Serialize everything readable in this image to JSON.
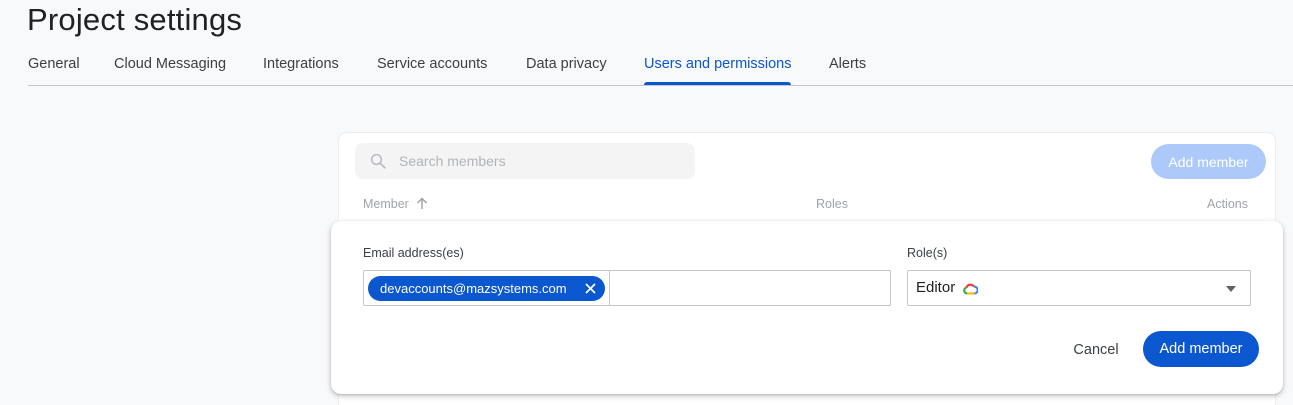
{
  "page": {
    "title": "Project settings"
  },
  "tabs": [
    {
      "label": "General",
      "active": false
    },
    {
      "label": "Cloud Messaging",
      "active": false
    },
    {
      "label": "Integrations",
      "active": false
    },
    {
      "label": "Service accounts",
      "active": false
    },
    {
      "label": "Data privacy",
      "active": false
    },
    {
      "label": "Users and permissions",
      "active": true
    },
    {
      "label": "Alerts",
      "active": false
    }
  ],
  "members": {
    "search_placeholder": "Search members",
    "add_member_label": "Add member",
    "columns": {
      "member": "Member",
      "roles": "Roles",
      "actions": "Actions"
    },
    "sort_icon": "arrow-up-icon"
  },
  "dialog": {
    "email_label": "Email address(es)",
    "email_chip": "devaccounts@mazsystems.com",
    "role_label": "Role(s)",
    "role_value": "Editor",
    "role_icon": "google-cloud-icon",
    "cancel_label": "Cancel",
    "add_member_label": "Add member"
  },
  "colors": {
    "accent": "#0b57d0",
    "accent_disabled": "#a8c7fa",
    "text": "#202124"
  }
}
